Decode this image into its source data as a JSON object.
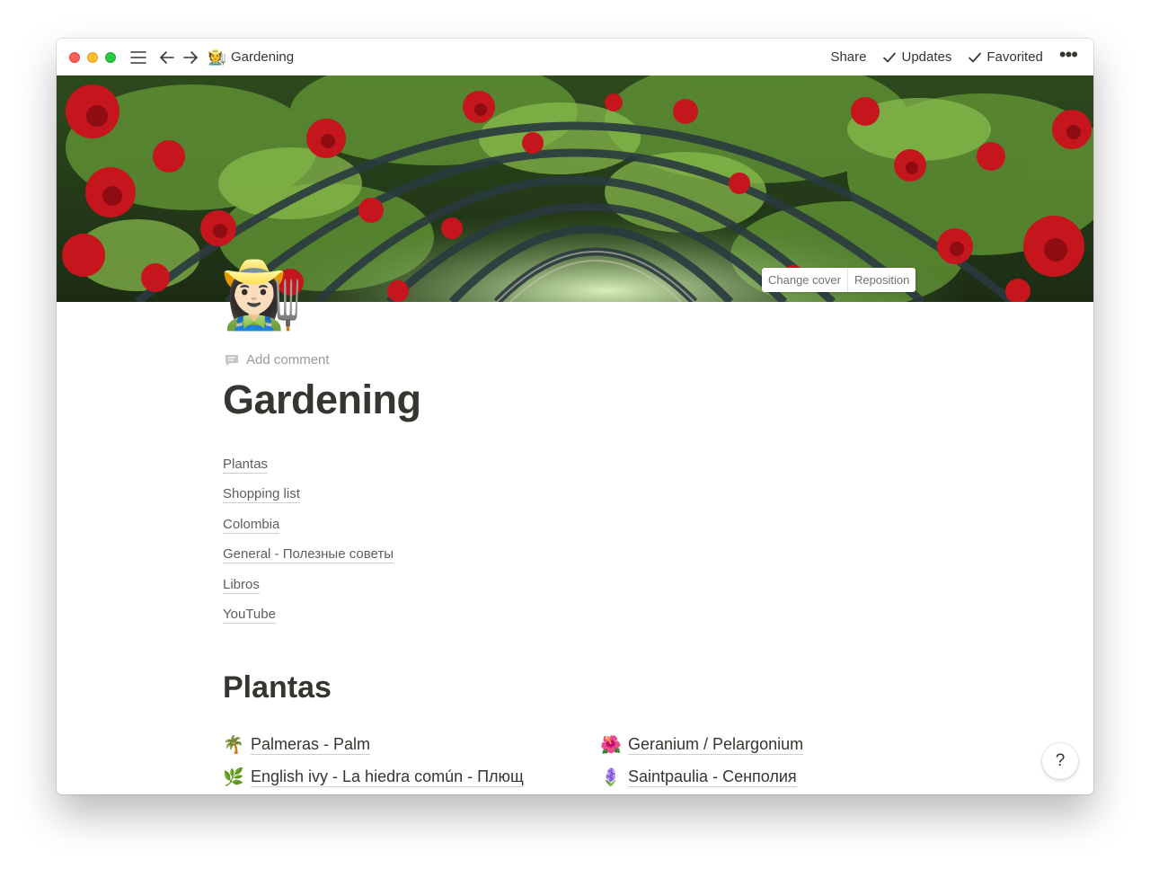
{
  "titlebar": {
    "breadcrumb_emoji": "🧑‍🌾",
    "breadcrumb_title": "Gardening",
    "share_label": "Share",
    "updates_label": "Updates",
    "favorited_label": "Favorited",
    "more_label": "•••"
  },
  "cover": {
    "change_cover_label": "Change cover",
    "reposition_label": "Reposition"
  },
  "page": {
    "icon": "👩🏻‍🌾",
    "add_comment_label": "Add comment",
    "title": "Gardening",
    "links": [
      "Plantas",
      "Shopping list",
      "Colombia",
      "General - Полезные советы",
      "Libros",
      "YouTube"
    ],
    "section_title": "Plantas",
    "subpages": [
      {
        "emoji": "🌴",
        "label": "Palmeras - Palm"
      },
      {
        "emoji": "🌺",
        "label": "Geranium / Pelargonium"
      },
      {
        "emoji": "🌿",
        "label": "English ivy - La hiedra común - Плющ"
      },
      {
        "emoji": "🪻",
        "label": "Saintpaulia - Сенполия"
      }
    ]
  },
  "help": {
    "label": "?"
  },
  "icons": [
    "menu-icon",
    "arrow-left-icon",
    "arrow-right-icon",
    "check-icon",
    "more-icon",
    "comment-icon"
  ]
}
